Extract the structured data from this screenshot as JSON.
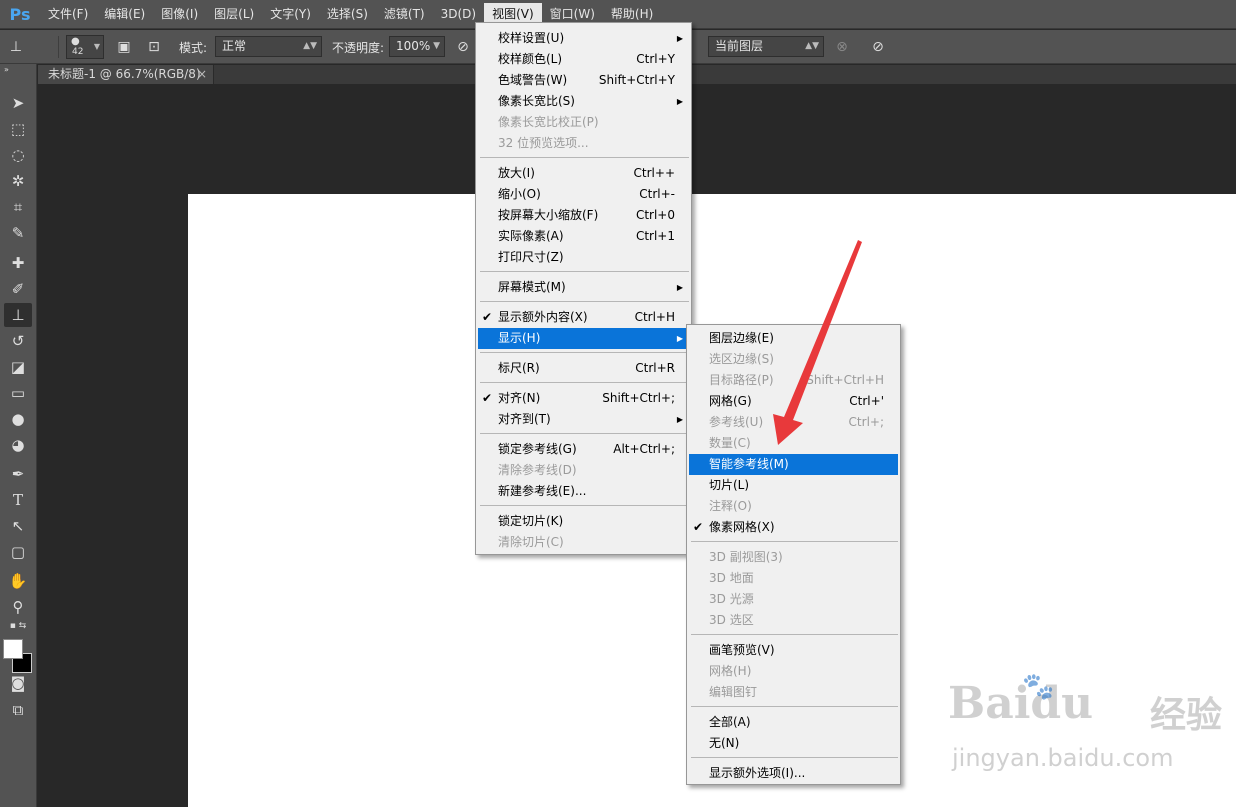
{
  "app": {
    "logo": "Ps"
  },
  "menubar": {
    "items": [
      "文件(F)",
      "编辑(E)",
      "图像(I)",
      "图层(L)",
      "文字(Y)",
      "选择(S)",
      "滤镜(T)",
      "3D(D)",
      "视图(V)",
      "窗口(W)",
      "帮助(H)"
    ]
  },
  "options": {
    "brush_size": "42",
    "mode_label": "模式:",
    "mode_value": "正常",
    "opacity_label": "不透明度:",
    "opacity_value": "100%",
    "sample_value": "当前图层"
  },
  "document_tab": {
    "title": "未标题-1 @ 66.7%(RGB/8)",
    "close": "×"
  },
  "view_menu": {
    "items": [
      {
        "label": "校样设置(U)",
        "shortcut": "",
        "submenu": true,
        "disabled": false
      },
      {
        "label": "校样颜色(L)",
        "shortcut": "Ctrl+Y",
        "disabled": false
      },
      {
        "label": "色域警告(W)",
        "shortcut": "Shift+Ctrl+Y",
        "disabled": false
      },
      {
        "label": "像素长宽比(S)",
        "shortcut": "",
        "submenu": true,
        "disabled": false
      },
      {
        "label": "像素长宽比校正(P)",
        "shortcut": "",
        "disabled": true
      },
      {
        "label": "32 位预览选项...",
        "shortcut": "",
        "disabled": true
      },
      {
        "label": "放大(I)",
        "shortcut": "Ctrl++",
        "disabled": false
      },
      {
        "label": "缩小(O)",
        "shortcut": "Ctrl+-",
        "disabled": false
      },
      {
        "label": "按屏幕大小缩放(F)",
        "shortcut": "Ctrl+0",
        "disabled": false
      },
      {
        "label": "实际像素(A)",
        "shortcut": "Ctrl+1",
        "disabled": false
      },
      {
        "label": "打印尺寸(Z)",
        "shortcut": "",
        "disabled": false
      },
      {
        "label": "屏幕模式(M)",
        "shortcut": "",
        "submenu": true,
        "disabled": false
      },
      {
        "label": "显示额外内容(X)",
        "shortcut": "Ctrl+H",
        "checked": true,
        "disabled": false
      },
      {
        "label": "显示(H)",
        "shortcut": "",
        "submenu": true,
        "highlighted": true,
        "disabled": false
      },
      {
        "label": "标尺(R)",
        "shortcut": "Ctrl+R",
        "disabled": false
      },
      {
        "label": "对齐(N)",
        "shortcut": "Shift+Ctrl+;",
        "checked": true,
        "disabled": false
      },
      {
        "label": "对齐到(T)",
        "shortcut": "",
        "submenu": true,
        "disabled": false
      },
      {
        "label": "锁定参考线(G)",
        "shortcut": "Alt+Ctrl+;",
        "disabled": false
      },
      {
        "label": "清除参考线(D)",
        "shortcut": "",
        "disabled": true
      },
      {
        "label": "新建参考线(E)...",
        "shortcut": "",
        "disabled": false
      },
      {
        "label": "锁定切片(K)",
        "shortcut": "",
        "disabled": false
      },
      {
        "label": "清除切片(C)",
        "shortcut": "",
        "disabled": true
      }
    ]
  },
  "show_submenu": {
    "items": [
      {
        "label": "图层边缘(E)",
        "shortcut": "",
        "disabled": false
      },
      {
        "label": "选区边缘(S)",
        "shortcut": "",
        "disabled": true
      },
      {
        "label": "目标路径(P)",
        "shortcut": "Shift+Ctrl+H",
        "disabled": true
      },
      {
        "label": "网格(G)",
        "shortcut": "Ctrl+'",
        "disabled": false
      },
      {
        "label": "参考线(U)",
        "shortcut": "Ctrl+;",
        "disabled": true
      },
      {
        "label": "数量(C)",
        "shortcut": "",
        "disabled": true
      },
      {
        "label": "智能参考线(M)",
        "shortcut": "",
        "highlighted": true,
        "disabled": false
      },
      {
        "label": "切片(L)",
        "shortcut": "",
        "disabled": false
      },
      {
        "label": "注释(O)",
        "shortcut": "",
        "disabled": true
      },
      {
        "label": "像素网格(X)",
        "shortcut": "",
        "checked": true,
        "disabled": false
      },
      {
        "label": "3D 副视图(3)",
        "shortcut": "",
        "disabled": true
      },
      {
        "label": "3D 地面",
        "shortcut": "",
        "disabled": true
      },
      {
        "label": "3D 光源",
        "shortcut": "",
        "disabled": true
      },
      {
        "label": "3D 选区",
        "shortcut": "",
        "disabled": true
      },
      {
        "label": "画笔预览(V)",
        "shortcut": "",
        "disabled": false
      },
      {
        "label": "网格(H)",
        "shortcut": "",
        "disabled": true
      },
      {
        "label": "编辑图钉",
        "shortcut": "",
        "disabled": true
      },
      {
        "label": "全部(A)",
        "shortcut": "",
        "disabled": false
      },
      {
        "label": "无(N)",
        "shortcut": "",
        "disabled": false
      },
      {
        "label": "显示额外选项(I)...",
        "shortcut": "",
        "disabled": false
      }
    ]
  },
  "watermark": {
    "brand": "Baidu",
    "brand_cn": "经验",
    "url": "jingyan.baidu.com"
  },
  "colors": {
    "highlight": "#0a74d9",
    "annotation_arrow": "#e8393b",
    "panel": "#535353"
  }
}
